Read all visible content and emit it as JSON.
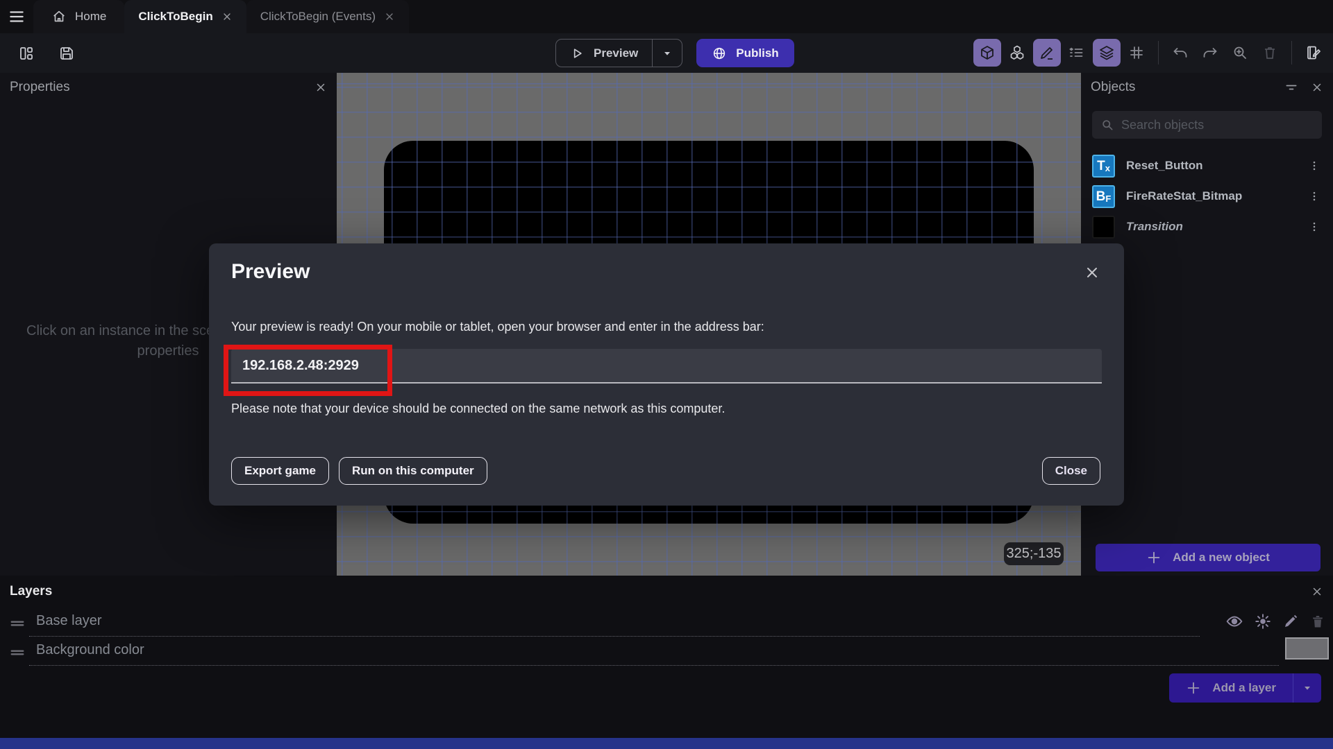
{
  "colors": {
    "accent_purple": "#3d2fae",
    "active_tool_bg": "#796bad",
    "annotation_red": "#e01515",
    "canvas_gray": "#6a6a6a",
    "grid_blue": "#566ab2",
    "bottom_bar_blue": "#26338a",
    "object_icon_blue": "#1778be"
  },
  "tabbar": {
    "home_tab": "Home",
    "scene_tab": "ClickToBegin",
    "events_tab": "ClickToBegin (Events)"
  },
  "toolbar": {
    "preview": "Preview",
    "publish": "Publish"
  },
  "properties": {
    "title": "Properties",
    "empty_message": "Click on an instance in the scene to display its properties"
  },
  "canvas": {
    "coordinates": "325;-135"
  },
  "objects": {
    "title": "Objects",
    "search_placeholder": "Search objects",
    "items": [
      {
        "name": "Reset_Button",
        "icon_big": "T",
        "icon_small": "x"
      },
      {
        "name": "FireRateStat_Bitmap",
        "icon_big": "B",
        "icon_small": "F"
      },
      {
        "name": "Transition",
        "icon_big": "",
        "icon_small": ""
      }
    ],
    "add_button": "Add a new object"
  },
  "layers": {
    "title": "Layers",
    "rows": [
      {
        "name": "Base layer"
      },
      {
        "name": "Background color"
      }
    ],
    "add_button": "Add a layer"
  },
  "dialog": {
    "title": "Preview",
    "body": "Your preview is ready! On your mobile or tablet, open your browser and enter in the address bar:",
    "address": "192.168.2.48:2929",
    "note": "Please note that your device should be connected on the same network as this computer.",
    "export_button": "Export game",
    "run_button": "Run on this computer",
    "close_button": "Close"
  }
}
